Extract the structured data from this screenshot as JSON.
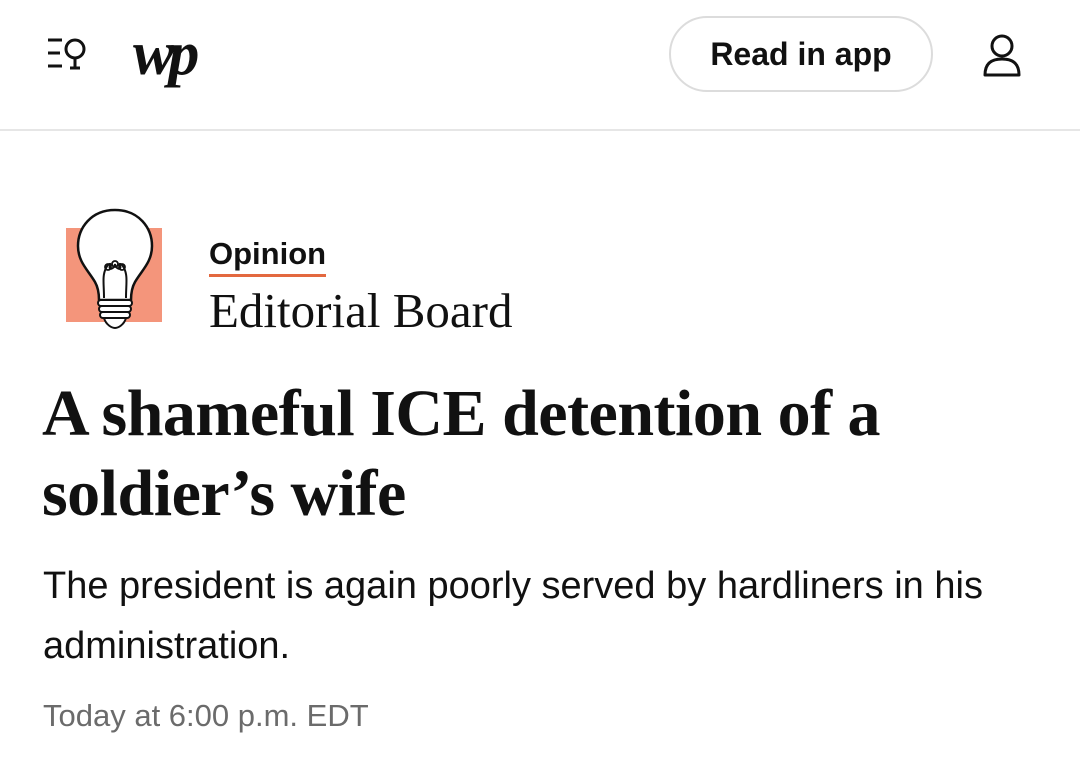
{
  "header": {
    "logo_text": "wp",
    "read_in_app_label": "Read in app",
    "menu_icon": "menu-search-icon",
    "account_icon": "account-icon"
  },
  "section": {
    "kicker": "Opinion",
    "byline": "Editorial Board",
    "illustration": "lightbulb-icon",
    "accent_color": "#f4957b",
    "underline_color": "#e3683f"
  },
  "article": {
    "headline": "A shameful ICE detention of a soldier’s wife",
    "dek": "The president is again poorly served by hardliners in his administration.",
    "timestamp": "Today at 6:00 p.m. EDT"
  }
}
